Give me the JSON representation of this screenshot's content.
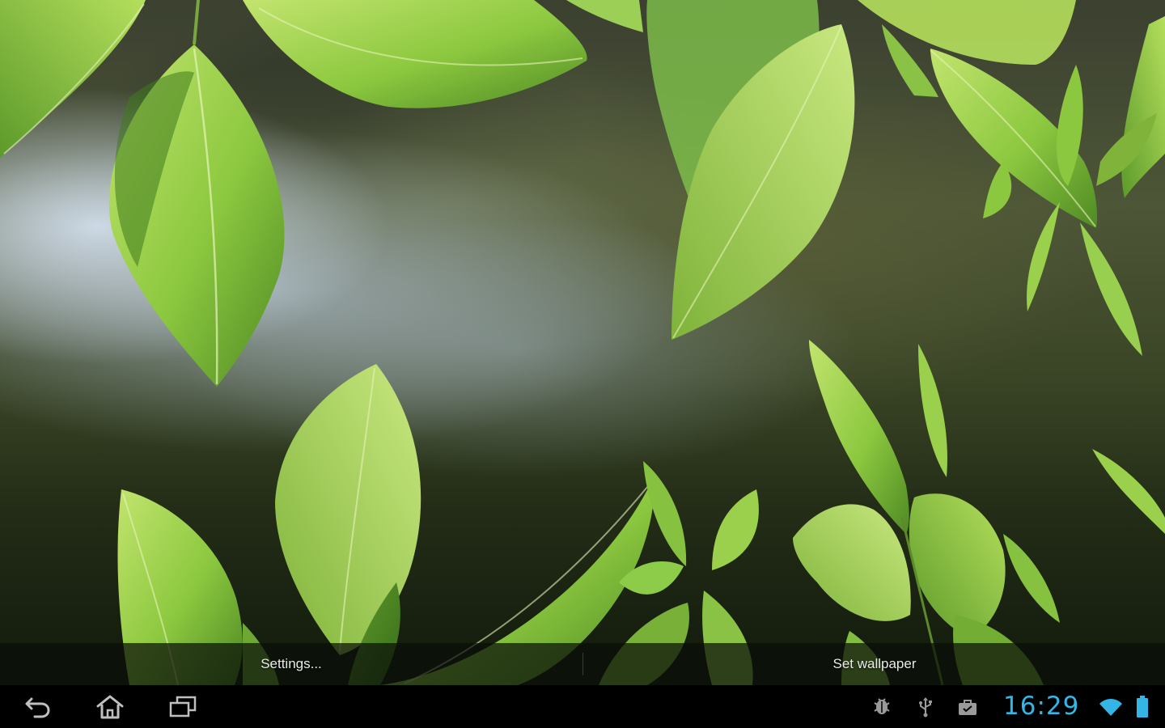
{
  "action_bar": {
    "settings_label": "Settings...",
    "set_wallpaper_label": "Set wallpaper"
  },
  "system_bar": {
    "clock": "16:29",
    "nav": [
      "back-icon",
      "home-icon",
      "recent-apps-icon"
    ],
    "status_icons": [
      "android-debug-icon",
      "usb-icon",
      "briefcase-icon",
      "wifi-icon",
      "battery-icon"
    ]
  },
  "colors": {
    "clock": "#33b5e5",
    "leaf_light": "#a6d65a",
    "leaf_dark": "#5f9a2c",
    "action_bar": "#0a0e08",
    "system_bar": "#000000"
  }
}
